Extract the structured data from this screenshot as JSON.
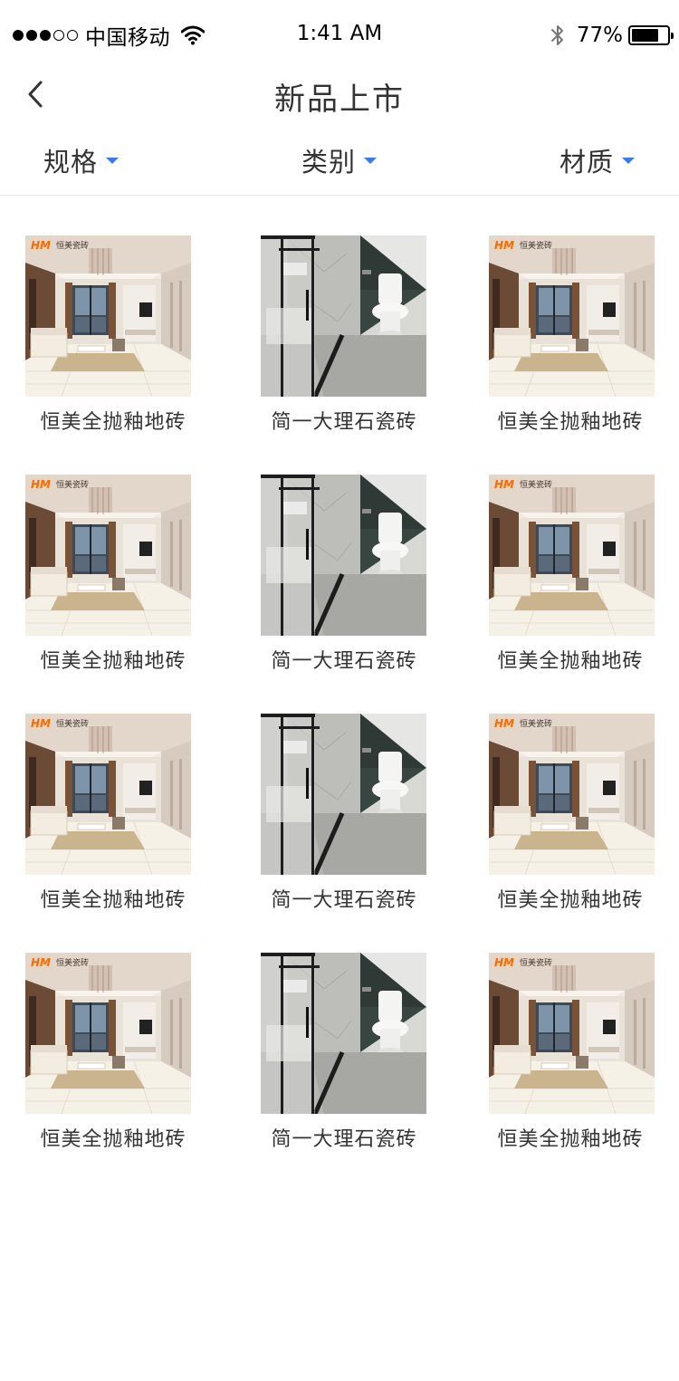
{
  "status_bar": {
    "carrier": "中国移动",
    "time": "1:41 AM",
    "battery_percent": "77%",
    "battery_level": 0.77,
    "signal_bars_filled": 3,
    "signal_bars_total": 5
  },
  "nav": {
    "title": "新品上市",
    "back_icon": "chevron-left-icon"
  },
  "filters": [
    {
      "label": "规格",
      "icon": "caret-down-icon"
    },
    {
      "label": "类别",
      "icon": "caret-down-icon"
    },
    {
      "label": "材质",
      "icon": "caret-down-icon"
    }
  ],
  "colors": {
    "accent": "#3b7ae8",
    "brand_logo": "#ff6a00",
    "text": "#333333"
  },
  "products": [
    {
      "title": "恒美全抛釉地砖",
      "image": "living-room",
      "logo_text": "恒美瓷砖"
    },
    {
      "title": "简一大理石瓷砖",
      "image": "bathroom"
    },
    {
      "title": "恒美全抛釉地砖",
      "image": "living-room",
      "logo_text": "恒美瓷砖"
    },
    {
      "title": "恒美全抛釉地砖",
      "image": "living-room",
      "logo_text": "恒美瓷砖"
    },
    {
      "title": "简一大理石瓷砖",
      "image": "bathroom"
    },
    {
      "title": "恒美全抛釉地砖",
      "image": "living-room",
      "logo_text": "恒美瓷砖"
    },
    {
      "title": "恒美全抛釉地砖",
      "image": "living-room",
      "logo_text": "恒美瓷砖"
    },
    {
      "title": "简一大理石瓷砖",
      "image": "bathroom"
    },
    {
      "title": "恒美全抛釉地砖",
      "image": "living-room",
      "logo_text": "恒美瓷砖"
    },
    {
      "title": "恒美全抛釉地砖",
      "image": "living-room",
      "logo_text": "恒美瓷砖"
    },
    {
      "title": "简一大理石瓷砖",
      "image": "bathroom"
    },
    {
      "title": "恒美全抛釉地砖",
      "image": "living-room",
      "logo_text": "恒美瓷砖"
    }
  ]
}
